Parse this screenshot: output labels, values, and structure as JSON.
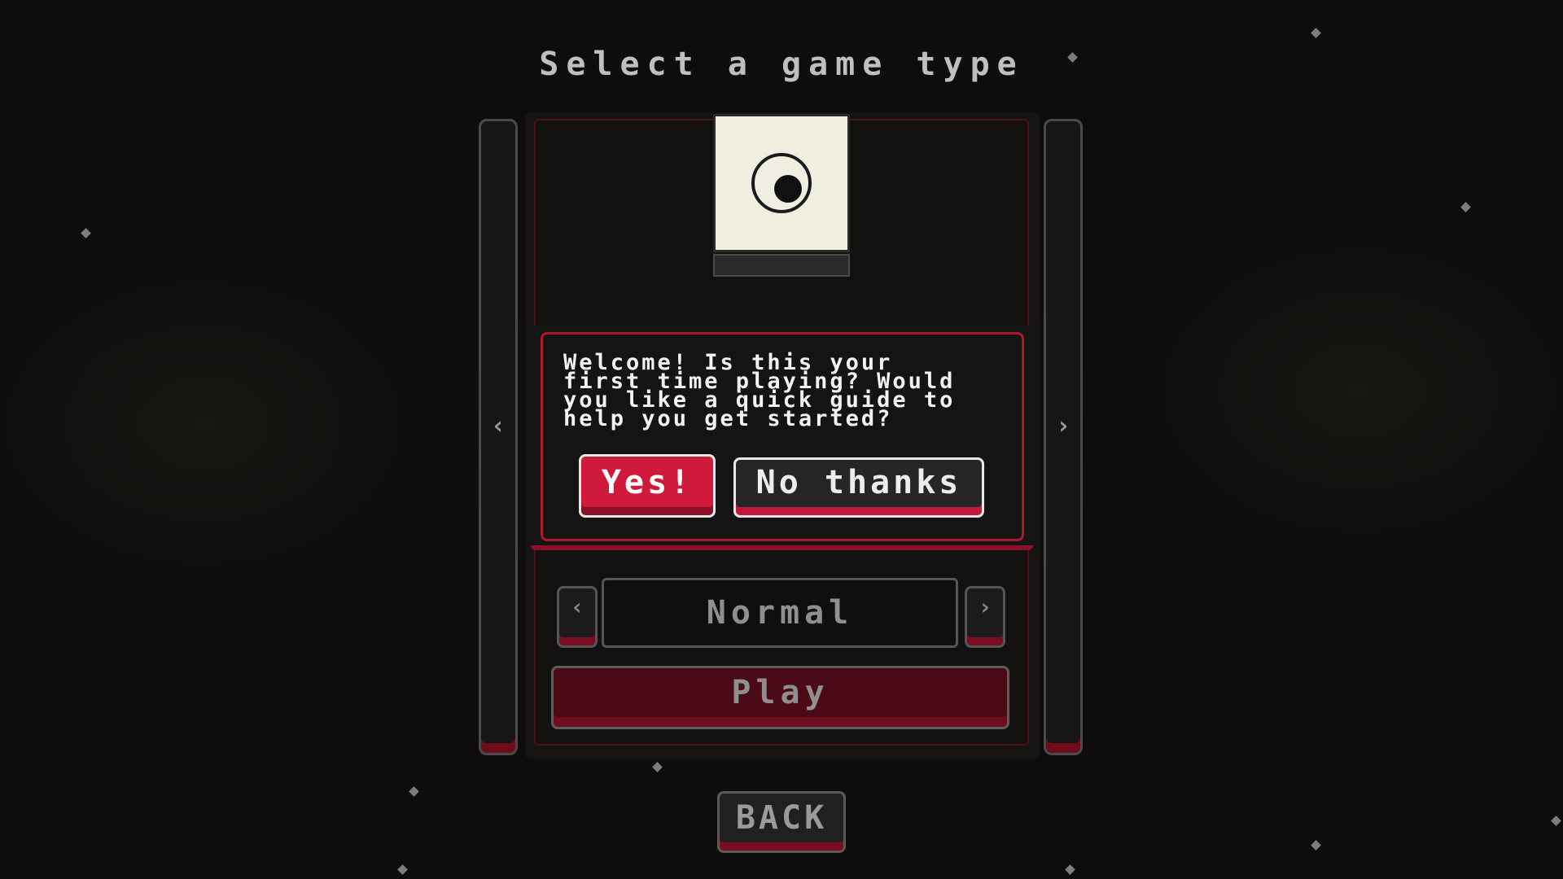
{
  "header": {
    "title": "Select a game type"
  },
  "carousel": {
    "prev_arrow": "‹",
    "next_arrow": "›",
    "card_icon": "eye-icon"
  },
  "dialog": {
    "message": "Welcome! Is this your\nfirst time playing? Would\nyou like a quick guide to\nhelp you get started?",
    "yes_label": "Yes!",
    "no_label": "No thanks"
  },
  "mode_selector": {
    "value": "Normal",
    "prev_arrow": "‹",
    "next_arrow": "›"
  },
  "play_label": "Play",
  "back_label": "BACK",
  "colors": {
    "accent_red": "#cf1a3c",
    "dark_red": "#4b0a17",
    "card_bg": "#efeee0",
    "background": "#0e0d0c"
  }
}
